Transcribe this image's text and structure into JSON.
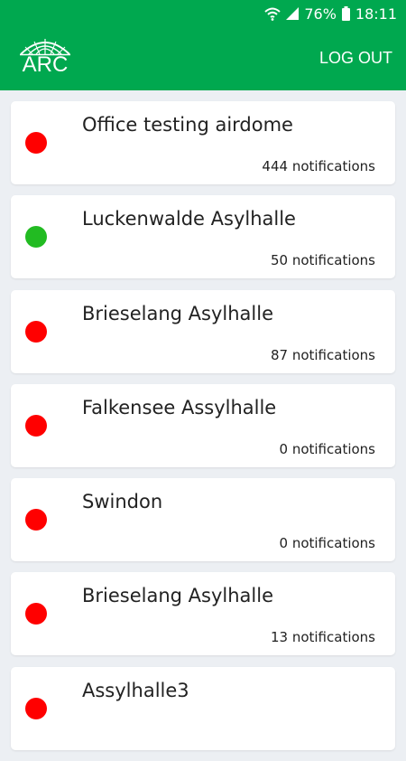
{
  "statusbar": {
    "battery_percent": "76%",
    "time": "18:11"
  },
  "appbar": {
    "logo_text": "ARC",
    "logout_label": "LOG OUT"
  },
  "colors": {
    "brand_green": "#00a84f",
    "status_red": "#ff0000",
    "status_green": "#22bb22"
  },
  "sites": [
    {
      "name": "Office testing airdome",
      "notifications": "444 notifications",
      "status": "red"
    },
    {
      "name": "Luckenwalde Asylhalle",
      "notifications": "50 notifications",
      "status": "green"
    },
    {
      "name": "Brieselang Asylhalle",
      "notifications": "87 notifications",
      "status": "red"
    },
    {
      "name": "Falkensee Assylhalle",
      "notifications": "0 notifications",
      "status": "red"
    },
    {
      "name": "Swindon",
      "notifications": "0 notifications",
      "status": "red"
    },
    {
      "name": "Brieselang Asylhalle",
      "notifications": "13 notifications",
      "status": "red"
    },
    {
      "name": "Assylhalle3",
      "notifications": "",
      "status": "red"
    }
  ]
}
